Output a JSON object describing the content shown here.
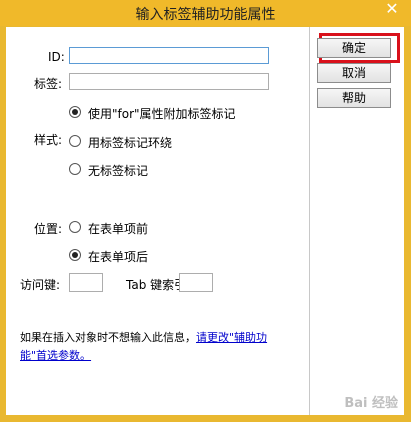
{
  "window": {
    "title": "输入标签辅助功能属性",
    "close": "✕"
  },
  "form": {
    "id_label": "ID:",
    "id_value": "",
    "tag_label": "标签:",
    "tag_value": "",
    "style_label": "样式:",
    "style_options": [
      {
        "label": "使用\"for\"属性附加标签标记",
        "checked": true
      },
      {
        "label": "用标签标记环绕",
        "checked": false
      },
      {
        "label": "无标签标记",
        "checked": false
      }
    ],
    "position_label": "位置:",
    "position_options": [
      {
        "label": "在表单项前",
        "checked": false
      },
      {
        "label": "在表单项后",
        "checked": true
      }
    ],
    "access_key_label": "访问键:",
    "tab_index_label": "Tab 键索引:"
  },
  "buttons": {
    "ok": "确定",
    "cancel": "取消",
    "help": "帮助"
  },
  "note": {
    "text": "如果在插入对象时不想输入此信息，",
    "link": "请更改\"辅助功能\"首选参数。"
  },
  "watermark": "Bai 经验",
  "colors": {
    "title_bar": "#f0b92a",
    "highlight": "#d9111b",
    "link": "#0000cc"
  }
}
